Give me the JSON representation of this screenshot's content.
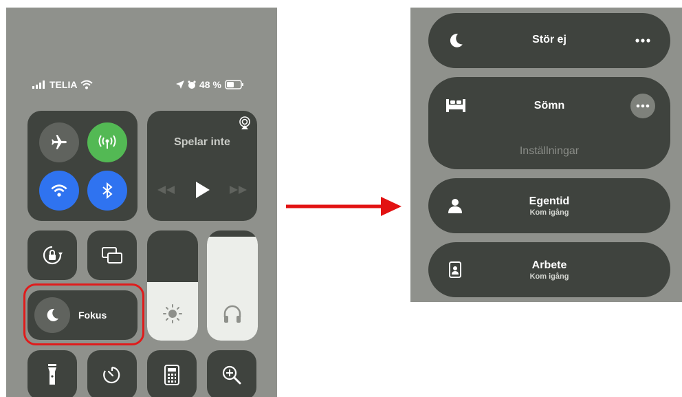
{
  "control_center": {
    "status_bar": {
      "carrier": "TELIA",
      "battery": "48 %"
    },
    "media": {
      "title": "Spelar inte"
    },
    "focus": {
      "label": "Fokus"
    }
  },
  "focus_menu": {
    "modes": [
      {
        "title": "Stör ej"
      },
      {
        "title": "Sömn",
        "settings": "Inställningar"
      },
      {
        "title": "Egentid",
        "subtitle": "Kom igång"
      },
      {
        "title": "Arbete",
        "subtitle": "Kom igång"
      }
    ]
  },
  "colors": {
    "connectivity_green": "#53b954",
    "connectivity_blue": "#2f73f0",
    "highlight_red": "#e01b1b",
    "arrow_red": "#e21212"
  }
}
